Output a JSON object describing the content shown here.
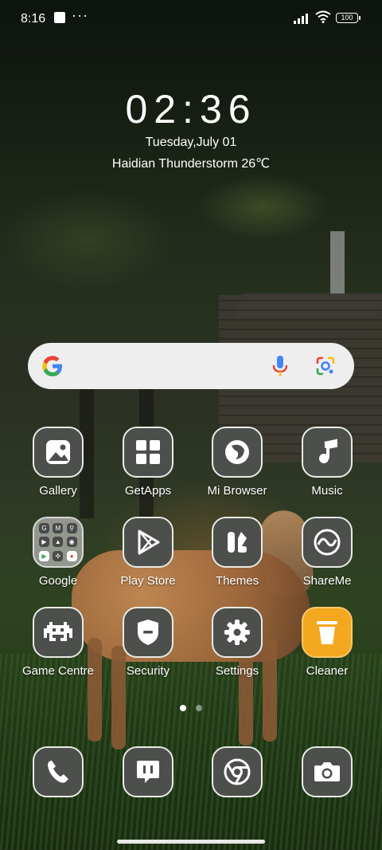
{
  "status_bar": {
    "time": "8:16",
    "battery": "100",
    "icons": [
      "notification-square-icon",
      "more-dots-icon",
      "signal-icon",
      "wifi-icon",
      "battery-icon"
    ]
  },
  "clock_widget": {
    "time": "02:36",
    "date": "Tuesday,July 01",
    "weather": "Haidian Thunderstorm 26℃"
  },
  "search_bar": {
    "icons": [
      "google-logo-icon",
      "microphone-icon",
      "google-lens-icon"
    ]
  },
  "apps": [
    {
      "label": "Gallery",
      "icon": "gallery-icon"
    },
    {
      "label": "GetApps",
      "icon": "getapps-icon"
    },
    {
      "label": "Mi Browser",
      "icon": "mi-browser-icon"
    },
    {
      "label": "Music",
      "icon": "music-icon"
    },
    {
      "label": "Google",
      "icon": "google-folder-icon"
    },
    {
      "label": "Play Store",
      "icon": "play-store-icon"
    },
    {
      "label": "Themes",
      "icon": "themes-icon"
    },
    {
      "label": "ShareMe",
      "icon": "shareme-icon"
    },
    {
      "label": "Game Centre",
      "icon": "game-centre-icon"
    },
    {
      "label": "Security",
      "icon": "security-icon"
    },
    {
      "label": "Settings",
      "icon": "settings-icon"
    },
    {
      "label": "Cleaner",
      "icon": "cleaner-icon"
    }
  ],
  "google_folder_minis": [
    "G",
    "M",
    "",
    "",
    "",
    "",
    "",
    "",
    ""
  ],
  "page_indicator": {
    "pages": 2,
    "current": 1
  },
  "dock": [
    {
      "icon": "phone-icon"
    },
    {
      "icon": "messages-icon"
    },
    {
      "icon": "chrome-icon"
    },
    {
      "icon": "camera-icon"
    }
  ],
  "colors": {
    "icon_bg": "#4d4f4c",
    "icon_border": "#e9ebe6",
    "cleaner_accent": "#f4a81f"
  }
}
